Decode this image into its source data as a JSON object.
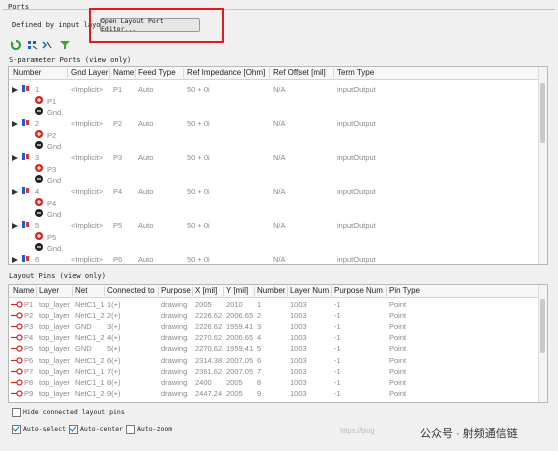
{
  "ports_section": {
    "title": "Ports",
    "defined_by_label": "Defined by input layout",
    "open_editor_button": "Open Layout Port Editor...",
    "sparam_title": "S-parameter Ports (view only)",
    "columns": [
      "Number",
      "Gnd Layer",
      "Name",
      "Feed Type",
      "Ref Impedance [Ohm]",
      "Ref Offset [mil]",
      "Term Type"
    ],
    "rows": [
      {
        "number": "1",
        "gnd": "<Implicit>",
        "name": "P1",
        "feed": "Auto",
        "imp": "50 + 0i",
        "offset": "N/A",
        "term": "inputOutput",
        "sub1": "P1",
        "sub2": "Gnd"
      },
      {
        "number": "2",
        "gnd": "<Implicit>",
        "name": "P2",
        "feed": "Auto",
        "imp": "50 + 0i",
        "offset": "N/A",
        "term": "inputOutput",
        "sub1": "P2",
        "sub2": "Gnd"
      },
      {
        "number": "3",
        "gnd": "<Implicit>",
        "name": "P3",
        "feed": "Auto",
        "imp": "50 + 0i",
        "offset": "N/A",
        "term": "inputOutput",
        "sub1": "P3",
        "sub2": "Gnd"
      },
      {
        "number": "4",
        "gnd": "<Implicit>",
        "name": "P4",
        "feed": "Auto",
        "imp": "50 + 0i",
        "offset": "N/A",
        "term": "inputOutput",
        "sub1": "P4",
        "sub2": "Gnd"
      },
      {
        "number": "5",
        "gnd": "<Implicit>",
        "name": "P5",
        "feed": "Auto",
        "imp": "50 + 0i",
        "offset": "N/A",
        "term": "inputOutput",
        "sub1": "P5",
        "sub2": "Gnd"
      },
      {
        "number": "6",
        "gnd": "<Implicit>",
        "name": "P6",
        "feed": "Auto",
        "imp": "50 + 0i",
        "offset": "N/A",
        "term": "inputOutput",
        "sub1": "",
        "sub2": ""
      }
    ]
  },
  "pins_section": {
    "title": "Layout Pins (view only)",
    "columns": [
      "Name",
      "Layer",
      "Net",
      "Connected to",
      "Purpose",
      "X [mil]",
      "Y [mil]",
      "Number",
      "Layer Num",
      "Purpose Num",
      "Pin Type"
    ],
    "rows": [
      [
        "P1",
        "top_layer",
        "NetC1_1",
        "1(+)",
        "drawing",
        "2005",
        "2010",
        "1",
        "1003",
        "-1",
        "Point"
      ],
      [
        "P2",
        "top_layer",
        "NetC1_2",
        "2(+)",
        "drawing",
        "2226.62",
        "2006.65",
        "2",
        "1003",
        "-1",
        "Point"
      ],
      [
        "P3",
        "top_layer",
        "GND",
        "3(+)",
        "drawing",
        "2226.62",
        "1959.41",
        "3",
        "1003",
        "-1",
        "Point"
      ],
      [
        "P4",
        "top_layer",
        "NetC1_2",
        "4(+)",
        "drawing",
        "2270.62",
        "2006.65",
        "4",
        "1003",
        "-1",
        "Point"
      ],
      [
        "P5",
        "top_layer",
        "GND",
        "5(+)",
        "drawing",
        "2270.62",
        "1959.41",
        "5",
        "1003",
        "-1",
        "Point"
      ],
      [
        "P6",
        "top_layer",
        "NetC1_2",
        "6(+)",
        "drawing",
        "2314.38",
        "2007.05",
        "6",
        "1003",
        "-1",
        "Point"
      ],
      [
        "P7",
        "top_layer",
        "NetC1_1",
        "7(+)",
        "drawing",
        "2361.62",
        "2007.05",
        "7",
        "1003",
        "-1",
        "Point"
      ],
      [
        "P8",
        "top_layer",
        "NetC1_1",
        "8(+)",
        "drawing",
        "2400",
        "2005",
        "8",
        "1003",
        "-1",
        "Point"
      ],
      [
        "P9",
        "top_layer",
        "NetC1_2",
        "9(+)",
        "drawing",
        "2447.24",
        "2005",
        "9",
        "1003",
        "-1",
        "Point"
      ]
    ]
  },
  "options": {
    "hide_connected": {
      "label": "Hide connected layout pins",
      "checked": false
    },
    "auto_select": {
      "label": "Auto-select",
      "checked": true
    },
    "auto_center": {
      "label": "Auto-center",
      "checked": true
    },
    "auto_zoom": {
      "label": "Auto-zoom",
      "checked": false
    }
  },
  "watermark": {
    "text": "公众号 · 射频通信链",
    "sub": "https://blog"
  },
  "colors": {
    "highlight": "#e01b1b",
    "accent": "#1a6fcf"
  }
}
